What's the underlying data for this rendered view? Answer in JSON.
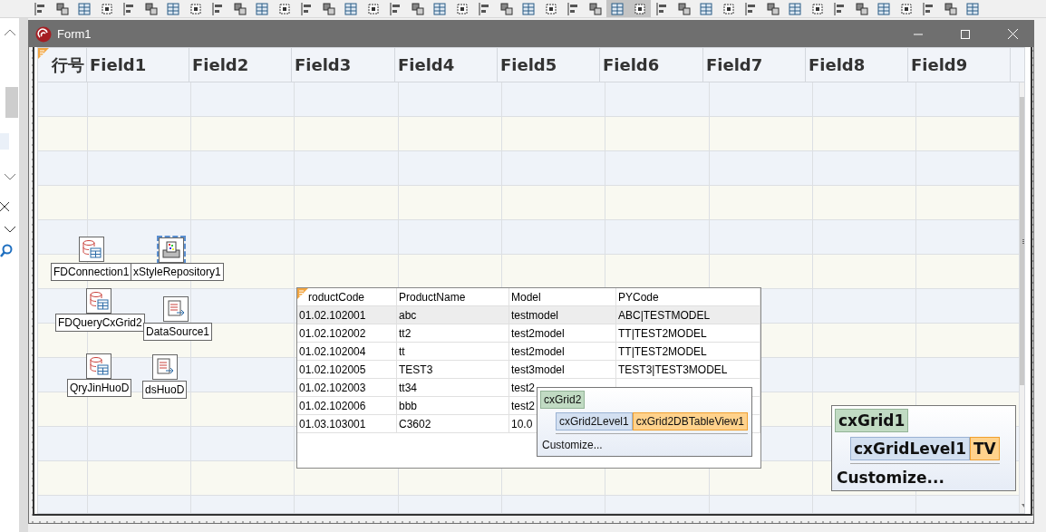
{
  "toolbar": {
    "buttons": [
      {
        "pressed": false
      },
      {
        "pressed": false
      },
      {
        "pressed": false
      },
      {
        "pressed": false
      },
      {
        "pressed": false
      },
      {
        "pressed": false
      },
      {
        "pressed": false
      },
      {
        "pressed": false
      },
      {
        "pressed": false
      },
      {
        "pressed": false
      },
      {
        "pressed": false
      },
      {
        "pressed": false
      },
      {
        "pressed": false
      },
      {
        "pressed": false
      },
      {
        "pressed": false
      },
      {
        "pressed": false
      },
      {
        "pressed": false
      },
      {
        "pressed": false
      },
      {
        "pressed": false
      },
      {
        "pressed": false
      },
      {
        "pressed": false
      },
      {
        "pressed": false
      },
      {
        "pressed": false
      },
      {
        "pressed": false
      },
      {
        "pressed": false
      },
      {
        "pressed": false
      },
      {
        "pressed": true
      },
      {
        "pressed": true
      },
      {
        "pressed": false
      },
      {
        "pressed": false
      },
      {
        "pressed": false
      },
      {
        "pressed": false
      },
      {
        "pressed": false
      },
      {
        "pressed": false
      },
      {
        "pressed": false
      },
      {
        "pressed": false
      },
      {
        "pressed": false
      },
      {
        "pressed": false
      },
      {
        "pressed": false
      },
      {
        "pressed": false
      },
      {
        "pressed": false
      },
      {
        "pressed": false
      },
      {
        "pressed": false
      }
    ]
  },
  "form": {
    "title": "Form1"
  },
  "grid1": {
    "columns": [
      "行号",
      "Field1",
      "Field2",
      "Field3",
      "Field4",
      "Field5",
      "Field6",
      "Field7",
      "Field8",
      "Field9"
    ]
  },
  "components": [
    {
      "label": "FDConnection1",
      "kind": "database",
      "selected": false
    },
    {
      "label": "xStyleRepository1",
      "kind": "style",
      "selected": true
    },
    {
      "label": "FDQueryCxGrid2",
      "kind": "database",
      "selected": false
    },
    {
      "label": "DataSource1",
      "kind": "datasource",
      "selected": false
    },
    {
      "label": "QryJinHuoD",
      "kind": "database",
      "selected": false
    },
    {
      "label": "dsHuoD",
      "kind": "datasource",
      "selected": false
    }
  ],
  "grid2": {
    "columns": [
      "roductCode",
      "ProductName",
      "Model",
      "PYCode"
    ],
    "rows": [
      {
        "cells": [
          "01.02.102001",
          "abc",
          "testmodel",
          "ABC|TESTMODEL"
        ],
        "selected": true
      },
      {
        "cells": [
          "01.02.102002",
          "tt2",
          "test2model",
          "TT|TEST2MODEL"
        ],
        "selected": false
      },
      {
        "cells": [
          "01.02.102004",
          "tt",
          "test2model",
          "TT|TEST2MODEL"
        ],
        "selected": false
      },
      {
        "cells": [
          "01.02.102005",
          "TEST3",
          "test3model",
          "TEST3|TEST3MODEL"
        ],
        "selected": false
      },
      {
        "cells": [
          "01.02.102003",
          "tt34",
          "test2"
        ],
        "selected": false
      },
      {
        "cells": [
          "01.02.102006",
          "bbb",
          "test2"
        ],
        "selected": false
      },
      {
        "cells": [
          "01.03.103001",
          "C3602",
          "10.0"
        ],
        "selected": false
      }
    ]
  },
  "popups": [
    {
      "kind": "small",
      "grid": "cxGrid2",
      "level": "cxGrid2Level1",
      "view": "cxGrid2DBTableView1",
      "action": "Customize..."
    },
    {
      "kind": "large",
      "grid": "cxGrid1",
      "level": "cxGridLevel1",
      "view": "TV",
      "action": "Customize..."
    }
  ]
}
